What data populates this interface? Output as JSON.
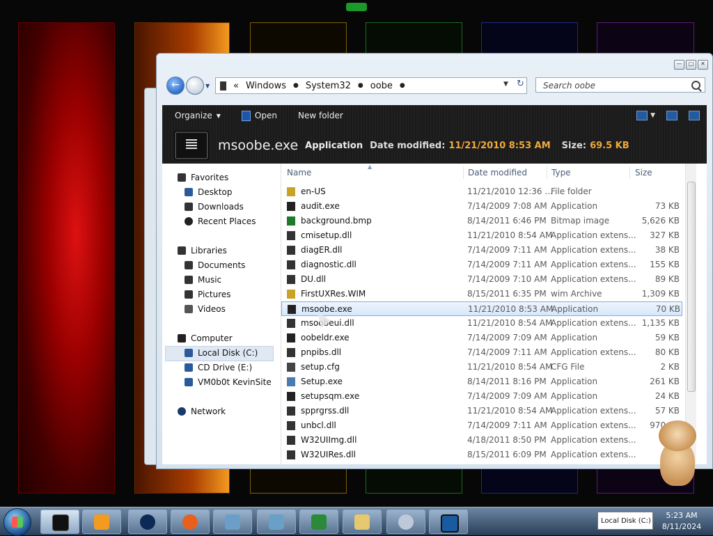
{
  "address_bar": {
    "crumbs": [
      "Windows",
      "System32",
      "oobe"
    ],
    "search_placeholder": "Search oobe"
  },
  "toolbar": {
    "organize": "Organize",
    "open": "Open",
    "new_folder": "New folder"
  },
  "details": {
    "name": "msoobe.exe",
    "type": "Application",
    "date_label": "Date modified:",
    "date_value": "11/21/2010 8:53 AM",
    "size_label": "Size:",
    "size_value": "69.5 KB"
  },
  "nav_pane": {
    "favorites": "Favorites",
    "desktop": "Desktop",
    "downloads": "Downloads",
    "recent": "Recent Places",
    "libraries": "Libraries",
    "documents": "Documents",
    "music": "Music",
    "pictures": "Pictures",
    "videos": "Videos",
    "computer": "Computer",
    "local_disk": "Local Disk (C:)",
    "cd_drive": "CD Drive (E:)",
    "vm": "VM0b0t KevinSite",
    "network": "Network"
  },
  "columns": {
    "name": "Name",
    "date": "Date modified",
    "type": "Type",
    "size": "Size"
  },
  "files": [
    {
      "name": "en-US",
      "date": "11/21/2010 12:36 ...",
      "type": "File folder",
      "size": ""
    },
    {
      "name": "audit.exe",
      "date": "7/14/2009 7:08 AM",
      "type": "Application",
      "size": "73 KB"
    },
    {
      "name": "background.bmp",
      "date": "8/14/2011 6:46 PM",
      "type": "Bitmap image",
      "size": "5,626 KB"
    },
    {
      "name": "cmisetup.dll",
      "date": "11/21/2010 8:54 AM",
      "type": "Application extens...",
      "size": "327 KB"
    },
    {
      "name": "diagER.dll",
      "date": "7/14/2009 7:11 AM",
      "type": "Application extens...",
      "size": "38 KB"
    },
    {
      "name": "diagnostic.dll",
      "date": "7/14/2009 7:11 AM",
      "type": "Application extens...",
      "size": "155 KB"
    },
    {
      "name": "DU.dll",
      "date": "7/14/2009 7:10 AM",
      "type": "Application extens...",
      "size": "89 KB"
    },
    {
      "name": "FirstUXRes.WIM",
      "date": "8/15/2011 6:35 PM",
      "type": "wim Archive",
      "size": "1,309 KB"
    },
    {
      "name": "msoobe.exe",
      "date": "11/21/2010 8:53 AM",
      "type": "Application",
      "size": "70 KB"
    },
    {
      "name": "msoobeui.dll",
      "date": "11/21/2010 8:54 AM",
      "type": "Application extens...",
      "size": "1,135 KB"
    },
    {
      "name": "oobeldr.exe",
      "date": "7/14/2009 7:09 AM",
      "type": "Application",
      "size": "59 KB"
    },
    {
      "name": "pnpibs.dll",
      "date": "7/14/2009 7:11 AM",
      "type": "Application extens...",
      "size": "80 KB"
    },
    {
      "name": "setup.cfg",
      "date": "11/21/2010 8:54 AM",
      "type": "CFG File",
      "size": "2 KB"
    },
    {
      "name": "Setup.exe",
      "date": "8/14/2011 8:16 PM",
      "type": "Application",
      "size": "261 KB"
    },
    {
      "name": "setupsqm.exe",
      "date": "7/14/2009 7:09 AM",
      "type": "Application",
      "size": "24 KB"
    },
    {
      "name": "spprgrss.dll",
      "date": "11/21/2010 8:54 AM",
      "type": "Application extens...",
      "size": "57 KB"
    },
    {
      "name": "unbcl.dll",
      "date": "7/14/2009 7:11 AM",
      "type": "Application extens...",
      "size": "970 KB"
    },
    {
      "name": "W32UIImg.dll",
      "date": "4/18/2011 8:50 PM",
      "type": "Application extens...",
      "size": "2,..."
    },
    {
      "name": "W32UIRes.dll",
      "date": "8/15/2011 6:09 PM",
      "type": "Application extens...",
      "size": ""
    }
  ],
  "taskbar": {
    "tray_popup": "Local Disk (C:)",
    "time": "5:23 AM",
    "date": "8/11/2024"
  }
}
